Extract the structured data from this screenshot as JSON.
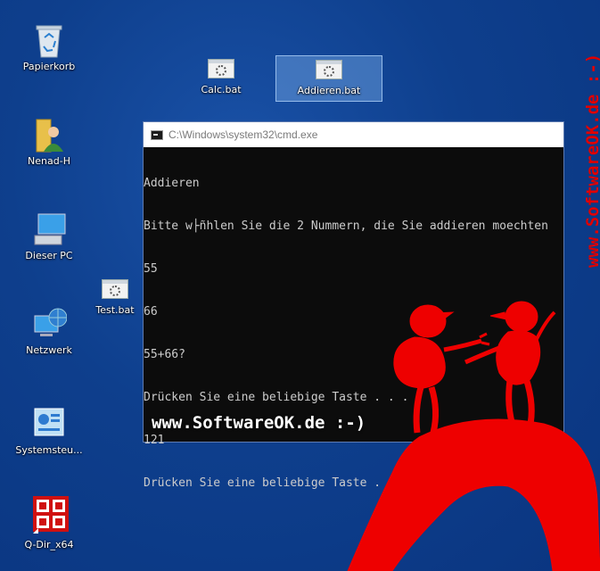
{
  "desktop": {
    "icons": [
      {
        "id": "recycle",
        "label": "Papierkorb"
      },
      {
        "id": "user",
        "label": "Nenad-H"
      },
      {
        "id": "pc",
        "label": "Dieser PC"
      },
      {
        "id": "net",
        "label": "Netzwerk"
      },
      {
        "id": "ctrl",
        "label": "Systemsteu..."
      },
      {
        "id": "qdir",
        "label": "Q-Dir_x64"
      },
      {
        "id": "calc",
        "label": "Calc.bat"
      },
      {
        "id": "add",
        "label": "Addieren.bat"
      },
      {
        "id": "test",
        "label": "Test.bat"
      }
    ]
  },
  "cmd": {
    "title": "C:\\Windows\\system32\\cmd.exe",
    "lines": [
      "Addieren",
      "Bitte w├ñhlen Sie die 2 Nummern, die Sie addieren moechten",
      "55",
      "66",
      "55+66?",
      "Drücken Sie eine beliebige Taste . . .",
      "121",
      "Drücken Sie eine beliebige Taste . . ."
    ]
  },
  "watermark": {
    "bottom": "www.SoftwareOK.de :-)",
    "side": "www.SoftwareOK.de :-)",
    "color": "#e00000"
  }
}
